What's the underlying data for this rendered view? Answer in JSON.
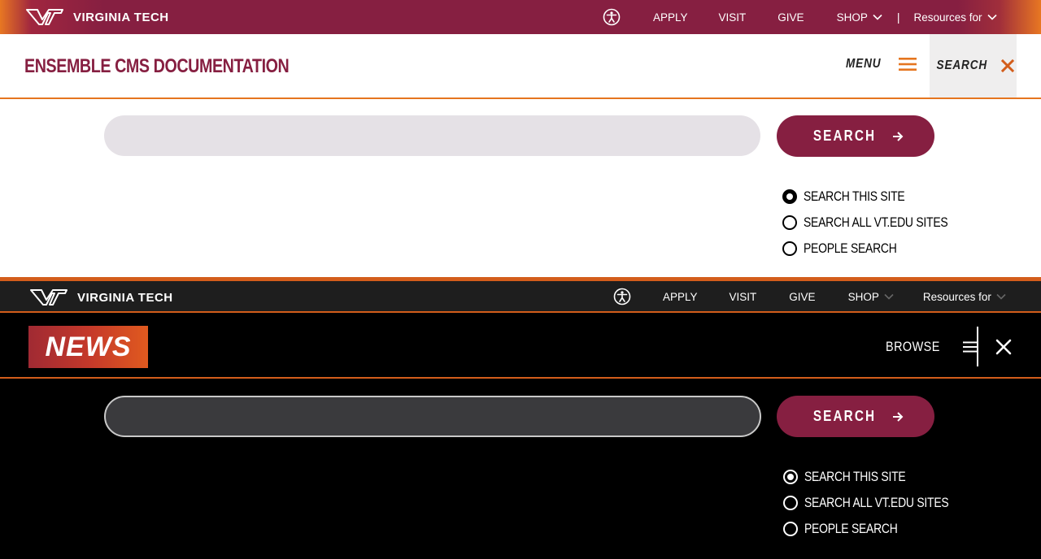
{
  "light": {
    "brand": "VIRGINIA TECH",
    "util_nav": {
      "accessibility_icon": "accessibility-icon",
      "apply": "APPLY",
      "visit": "VISIT",
      "give": "GIVE",
      "shop": "SHOP",
      "separator": "|",
      "resources": "Resources for"
    },
    "site_title": "ENSEMBLE CMS DOCUMENTATION",
    "menu_label": "MENU",
    "search_toggle_label": "SEARCH",
    "search_input": {
      "value": "",
      "placeholder": ""
    },
    "search_button": "SEARCH",
    "radios": [
      {
        "label": "SEARCH THIS SITE",
        "checked": true
      },
      {
        "label": "SEARCH ALL VT.EDU SITES",
        "checked": false
      },
      {
        "label": "PEOPLE SEARCH",
        "checked": false
      }
    ]
  },
  "dark": {
    "brand": "VIRGINIA TECH",
    "util_nav": {
      "accessibility_icon": "accessibility-icon",
      "apply": "APPLY",
      "visit": "VISIT",
      "give": "GIVE",
      "shop": "SHOP",
      "resources": "Resources for"
    },
    "news_logo": "NEWS",
    "browse_label": "BROWSE",
    "search_input": {
      "value": "",
      "placeholder": ""
    },
    "search_button": "SEARCH",
    "radios": [
      {
        "label": "SEARCH THIS SITE",
        "checked": true
      },
      {
        "label": "SEARCH ALL VT.EDU SITES",
        "checked": false
      },
      {
        "label": "PEOPLE SEARCH",
        "checked": false
      }
    ]
  },
  "colors": {
    "maroon": "#861f41",
    "orange": "#e5751f",
    "light_input": "#e5e1e6",
    "dark_input": "#3a3a3d"
  }
}
